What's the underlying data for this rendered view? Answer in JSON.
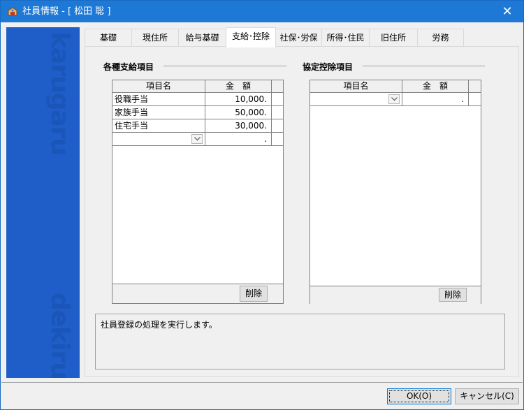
{
  "window": {
    "title": "社員情報 - [ 松田 聡 ]",
    "close_glyph": "✕"
  },
  "brand": {
    "top_text": "karugaru",
    "bottom_text": "dekiru"
  },
  "tabs": [
    {
      "label": "基礎",
      "active": false
    },
    {
      "label": "現住所",
      "active": false
    },
    {
      "label": "給与基礎",
      "active": false
    },
    {
      "label": "支給･控除",
      "active": true
    },
    {
      "label": "社保･労保",
      "active": false
    },
    {
      "label": "所得･住民",
      "active": false
    },
    {
      "label": "旧住所",
      "active": false
    },
    {
      "label": "労務",
      "active": false
    }
  ],
  "allowance": {
    "title": "各種支給項目",
    "columns": [
      "項目名",
      "金　額"
    ],
    "rows": [
      {
        "name": "役職手当",
        "amount": "10,000."
      },
      {
        "name": "家族手当",
        "amount": "50,000."
      },
      {
        "name": "住宅手当",
        "amount": "30,000."
      }
    ],
    "new_row_amount": ".",
    "delete_label": "削除"
  },
  "deduction": {
    "title": "協定控除項目",
    "columns": [
      "項目名",
      "金　額"
    ],
    "new_row_amount": ".",
    "delete_label": "削除"
  },
  "message": "社員登録の処理を実行します。",
  "buttons": {
    "ok": "OK(O)",
    "cancel": "キャンセル(C)"
  },
  "colors": {
    "titlebar": "#1e78d6",
    "brand_strip": "#1f5ec9"
  }
}
